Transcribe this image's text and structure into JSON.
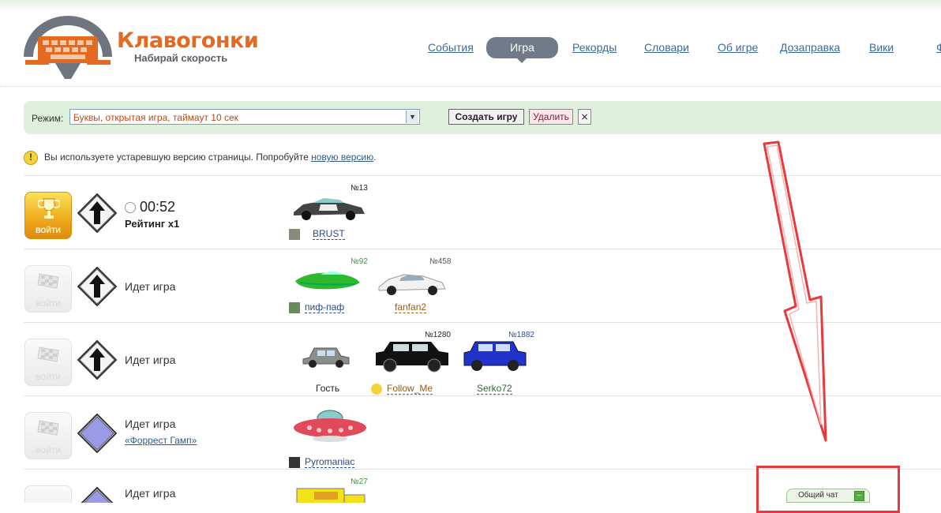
{
  "logo": {
    "title": "Клавогонки",
    "subtitle": "Набирай скорость"
  },
  "nav": {
    "items": [
      "События",
      "Игра",
      "Рекорды",
      "Словари",
      "Об игре",
      "Дозаправка",
      "Вики",
      "Ф"
    ],
    "active_index": 1
  },
  "mode": {
    "label": "Режим:",
    "selected": "Буквы, открытая игра, таймаут 10 сек",
    "create_button": "Создать игру",
    "delete_button": "Удалить",
    "close_button": "×"
  },
  "notice": {
    "text": "Вы используете устаревшую версию страницы. Попробуйте",
    "link": "новую версию",
    "tail": "."
  },
  "enter_label": "ВОЙТИ",
  "games": [
    {
      "timer": "00:52",
      "rating_label": "Рейтинг",
      "rating_value": "x1",
      "cars": [
        {
          "num": "№13",
          "name": "BRUST"
        }
      ]
    },
    {
      "status": "Идет игра",
      "cars": [
        {
          "num": "№92",
          "name": "пиф-паф"
        },
        {
          "num": "№458",
          "name": "fanfan2"
        }
      ]
    },
    {
      "status": "Идет игра",
      "cars": [
        {
          "num": "",
          "name": "Гость"
        },
        {
          "num": "№1280",
          "name": "Follow_Me"
        },
        {
          "num": "№1882",
          "name": "Serko72"
        }
      ]
    },
    {
      "status": "Идет игра",
      "vocabulary": "«Форрест Гамп»",
      "cars": [
        {
          "num": "",
          "name": "Pyromaniac"
        }
      ]
    },
    {
      "status": "Идет игра",
      "cars": [
        {
          "num": "№27",
          "name": ""
        }
      ]
    }
  ],
  "chat": {
    "label": "Общий чат",
    "minimize": "–"
  },
  "colors": {
    "accent_orange": "#e46a22",
    "nav_link": "#3a6a9a",
    "mode_bar": "#dff0dc",
    "highlight_red": "#e83a3a"
  }
}
